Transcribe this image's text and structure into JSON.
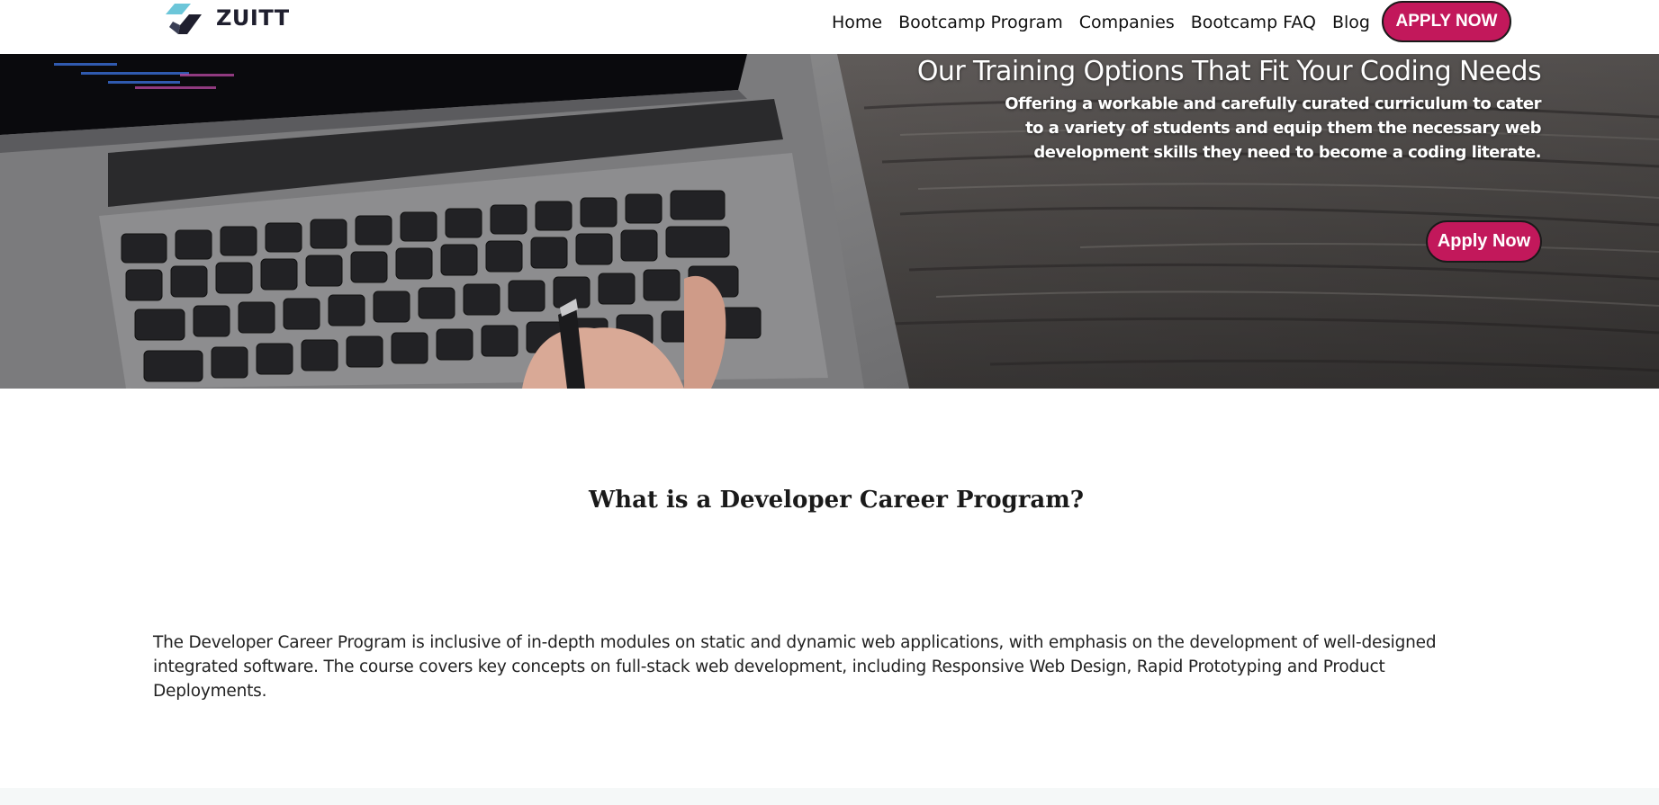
{
  "header": {
    "brand_name": "ZUITT",
    "nav": [
      {
        "label": "Home"
      },
      {
        "label": "Bootcamp Program"
      },
      {
        "label": "Companies"
      },
      {
        "label": "Bootcamp FAQ"
      },
      {
        "label": "Blog"
      }
    ],
    "apply_label": "APPLY NOW"
  },
  "hero": {
    "title": "Our Training Options That Fit Your Coding Needs",
    "subtitle": "Offering a workable and carefully curated curriculum to cater to a variety of students and equip them the necessary web development skills they need to become a coding literate.",
    "apply_label": "Apply Now"
  },
  "section": {
    "heading": "What is a Developer Career Program?",
    "body": "The Developer Career Program is inclusive of in-depth modules on static and dynamic web applications, with emphasis on the development of well-designed integrated software. The course covers key concepts on full-stack web development, including Responsive Web Design, Rapid Prototyping and Product Deployments."
  },
  "colors": {
    "accent": "#c2185b",
    "logo_light": "#6cc6d9",
    "logo_dark": "#1f1f2e",
    "footer_band": "#f5f8f8"
  }
}
